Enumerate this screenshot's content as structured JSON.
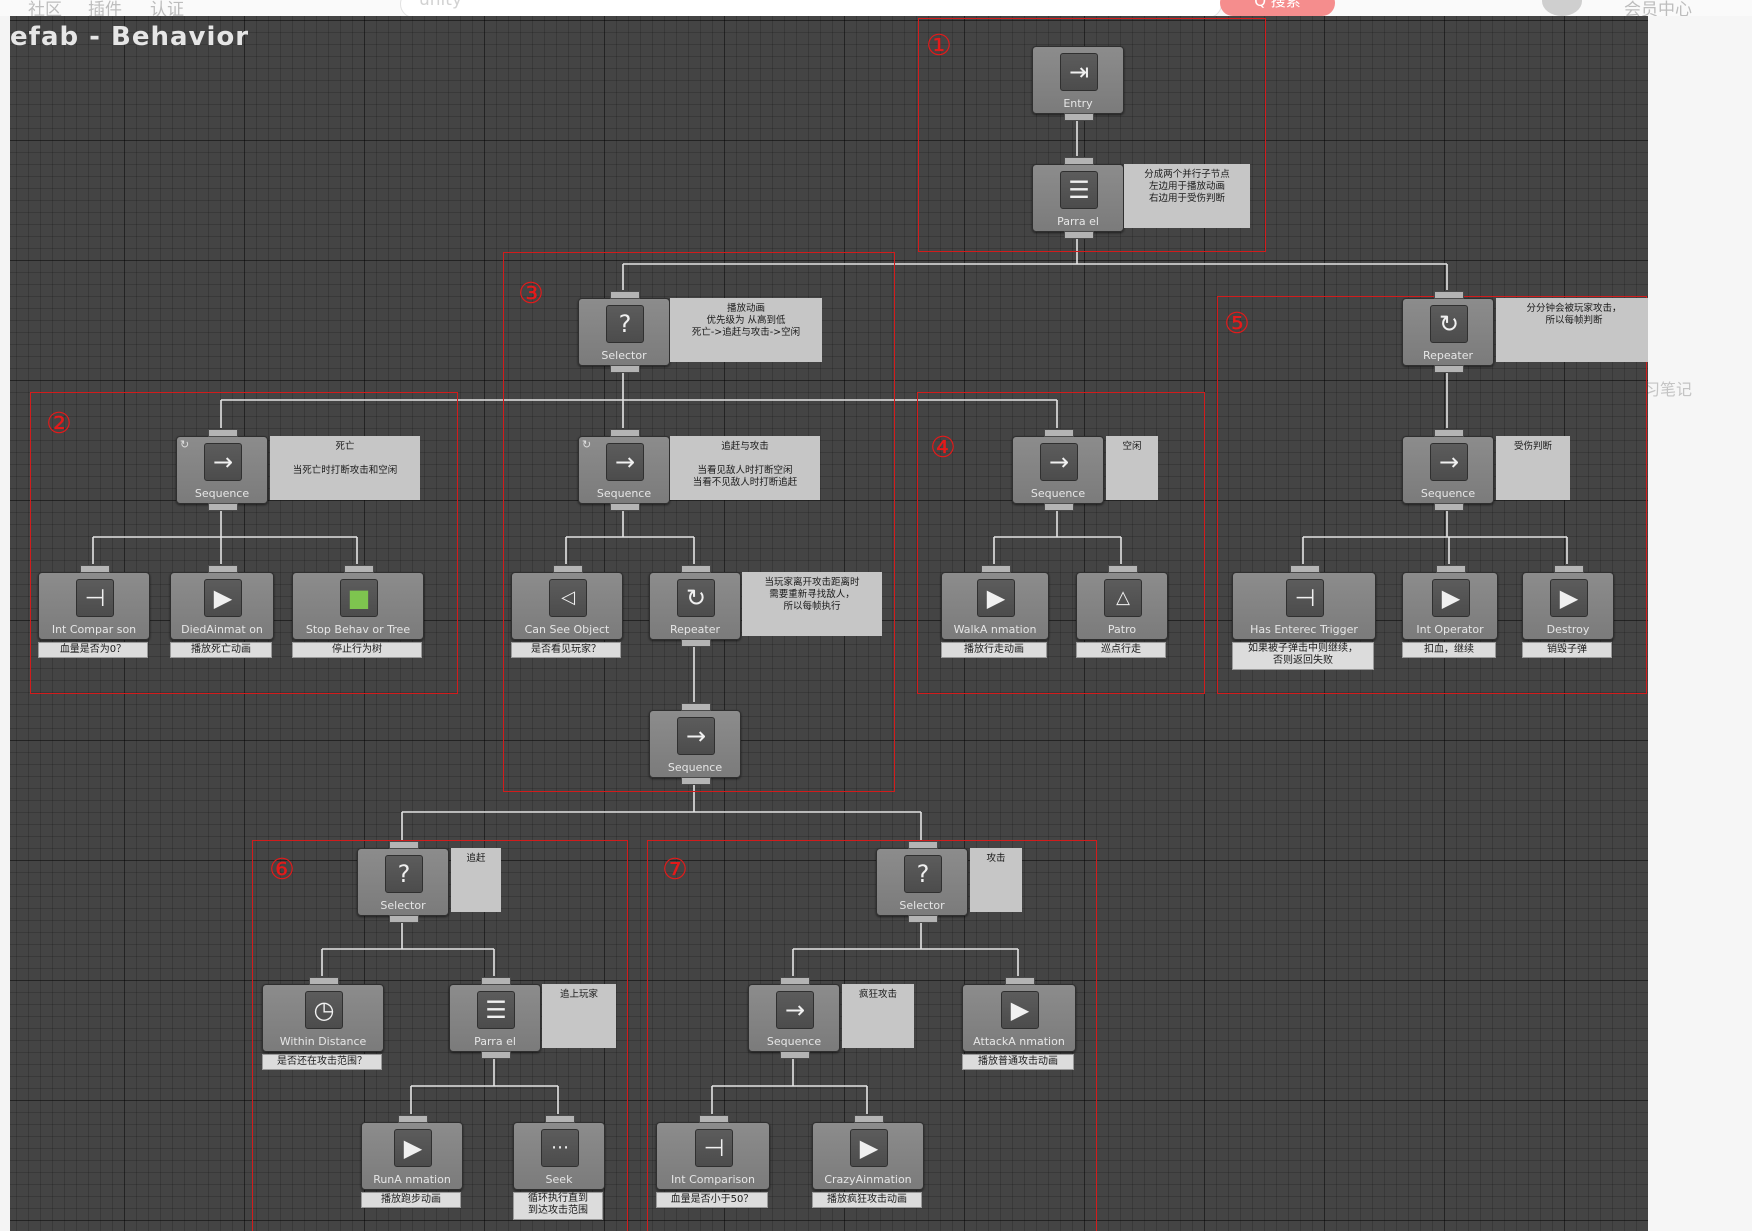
{
  "topbar": {
    "left_items": [
      "社区",
      "插件",
      "认证"
    ],
    "search_value": "unity",
    "search_button": "Q 搜索",
    "right_label": "会员中心"
  },
  "right_note": "习笔记",
  "window": {
    "title": "efab - Behavior"
  },
  "colors": {
    "canvas": "#444444",
    "node": "#838383",
    "comment": "#c6c6c6",
    "group_border": "#d21c1c"
  },
  "groups": [
    {
      "id": "g1",
      "number": "①"
    },
    {
      "id": "g2",
      "number": "②"
    },
    {
      "id": "g3",
      "number": "③"
    },
    {
      "id": "g4",
      "number": "④"
    },
    {
      "id": "g5",
      "number": "⑤"
    },
    {
      "id": "g6",
      "number": "⑥"
    },
    {
      "id": "g7",
      "number": "⑦"
    }
  ],
  "nodes": {
    "entry": {
      "label": "Entry",
      "icon": "entry-icon"
    },
    "parallel_root": {
      "label": "Parra el",
      "icon": "parallel-icon",
      "comment": "分成两个并行子节点\n左边用于播放动画\n右边用于受伤判断"
    },
    "selector_main": {
      "label": "Selector",
      "icon": "selector-icon",
      "comment": "播放动画\n优先级为 从高到低\n死亡->追赶与攻击->空闲"
    },
    "repeater_right": {
      "label": "Repeater",
      "icon": "repeater-icon",
      "comment": "分分钟会被玩家攻击，\n所以每帧判断"
    },
    "sequence_death": {
      "label": "Sequence",
      "icon": "sequence-icon",
      "comment": "死亡\n\n当死亡时打断攻击和空闲"
    },
    "sequence_chase_attack": {
      "label": "Sequence",
      "icon": "sequence-icon",
      "comment": "追赶与攻击\n\n当看见敌人时打断空闲\n当看不见敌人时打断追赶"
    },
    "sequence_idle": {
      "label": "Sequence",
      "icon": "sequence-icon",
      "comment": "空闲"
    },
    "sequence_hurt": {
      "label": "Sequence",
      "icon": "sequence-icon",
      "comment": "受伤判断"
    },
    "int_comparison_death": {
      "label": "Int Compar son",
      "icon": "int-comparison-icon",
      "caption": "血量是否为0？"
    },
    "died_animation": {
      "label": "DiedAinmat on",
      "icon": "play-icon",
      "caption": "播放死亡动画"
    },
    "stop_behavior_tree": {
      "label": "Stop Behav or Tree",
      "icon": "stop-tree-icon",
      "caption": "停止行为树"
    },
    "can_see_object": {
      "label": "Can See Object",
      "icon": "eye-icon",
      "caption": "是否看见玩家？"
    },
    "repeater_middle": {
      "label": "Repeater",
      "icon": "repeater-icon",
      "comment": "当玩家离开攻击距离时\n需要重新寻找敌人，\n所以每帧执行"
    },
    "walk_animation": {
      "label": "WalkA nmation",
      "icon": "play-icon",
      "caption": "播放行走动画"
    },
    "patrol": {
      "label": "Patro",
      "icon": "patrol-icon",
      "caption": "巡点行走"
    },
    "has_entered_trigger": {
      "label": "Has Enterec Trigger",
      "icon": "trigger-icon",
      "caption": "如果被子弹击中则继续，\n否则返回失败"
    },
    "int_operator": {
      "label": "Int Operator",
      "icon": "play-icon",
      "caption": "扣血，继续"
    },
    "destroy": {
      "label": "Destroy",
      "icon": "play-icon",
      "caption": "销毁子弹"
    },
    "sequence_middle": {
      "label": "Sequence",
      "icon": "sequence-icon"
    },
    "selector_chase": {
      "label": "Selector",
      "icon": "selector-icon",
      "comment": "追赶"
    },
    "selector_attack": {
      "label": "Selector",
      "icon": "selector-icon",
      "comment": "攻击"
    },
    "within_distance": {
      "label": "Within Distance",
      "icon": "distance-icon",
      "caption": "是否还在攻击范围？"
    },
    "parallel_chase": {
      "label": "Parra el",
      "icon": "parallel-icon",
      "comment": "追上玩家"
    },
    "sequence_rage": {
      "label": "Sequence",
      "icon": "sequence-icon",
      "comment": "疯狂攻击"
    },
    "attack_animation": {
      "label": "AttackA nmation",
      "icon": "play-icon",
      "caption": "播放普通攻击动画"
    },
    "run_animation": {
      "label": "RunA nmation",
      "icon": "play-icon",
      "caption": "播放跑步动画"
    },
    "seek": {
      "label": "Seek",
      "icon": "seek-icon",
      "caption": "循环执行直到\n到达攻击范围"
    },
    "int_comparison_hp": {
      "label": "Int Comparison",
      "icon": "int-comparison-icon",
      "caption": "血量是否小于50？"
    },
    "crazy_animation": {
      "label": "CrazyAinmation",
      "icon": "play-icon",
      "caption": "播放疯狂攻击动画"
    }
  }
}
